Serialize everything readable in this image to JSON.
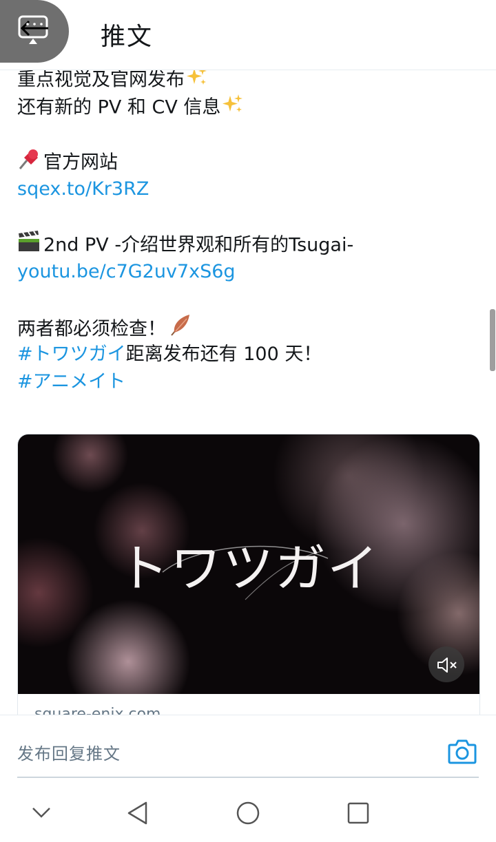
{
  "header": {
    "title": "推文",
    "back_icon": "back-arrow-icon"
  },
  "tweet": {
    "line1": "重点视觉及官网发布",
    "line2": "还有新的 PV 和 CV 信息",
    "official_site_label": "官方网站",
    "official_site_link": "sqex.to/Kr3RZ",
    "pv_label": "2nd PV -介绍世界观和所有的Tsugai-",
    "pv_link": "youtu.be/c7G2uv7xS6g",
    "must_check": "两者都必须检查！",
    "hashtag1": "#トワツガイ",
    "hashtag1_suffix": "距离发布还有 100 天！",
    "hashtag2": "#アニメイト",
    "emojis": [
      "sparkles-icon",
      "pushpin-icon",
      "clapper-board-icon",
      "feather-icon"
    ]
  },
  "card": {
    "video_title": "トワツガイ",
    "domain": "square-enix.com",
    "mute_icon": "volume-mute-icon"
  },
  "reply": {
    "placeholder": "发布回复推文",
    "camera_icon": "camera-icon"
  },
  "nav": {
    "icons": [
      "chevron-down-icon",
      "nav-back-icon",
      "nav-home-icon",
      "nav-recents-icon"
    ]
  },
  "colors": {
    "link": "#1b95e0",
    "text": "#14171a",
    "secondary": "#657786"
  }
}
